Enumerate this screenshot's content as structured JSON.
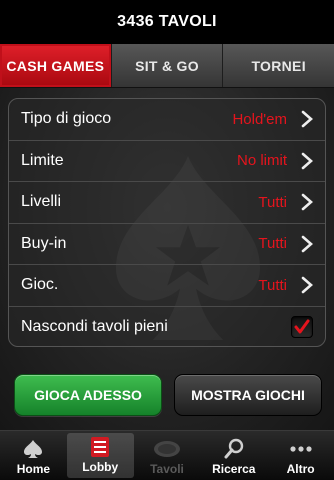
{
  "header": {
    "title": "3436 TAVOLI"
  },
  "segments": [
    {
      "label": "CASH GAMES",
      "active": true
    },
    {
      "label": "SIT & GO",
      "active": false
    },
    {
      "label": "TORNEI",
      "active": false
    }
  ],
  "settings": [
    {
      "label": "Tipo di gioco",
      "value": "Hold'em"
    },
    {
      "label": "Limite",
      "value": "No limit"
    },
    {
      "label": "Livelli",
      "value": "Tutti"
    },
    {
      "label": "Buy-in",
      "value": "Tutti"
    },
    {
      "label": "Gioc.",
      "value": "Tutti"
    }
  ],
  "hide_full": {
    "label": "Nascondi tavoli pieni",
    "checked": true
  },
  "actions": {
    "play_label": "GIOCA ADESSO",
    "show_label": "MOSTRA GIOCHI"
  },
  "tabs": [
    {
      "label": "Home",
      "icon": "spade-icon"
    },
    {
      "label": "Lobby",
      "icon": "lobby-icon",
      "active": true
    },
    {
      "label": "Tavoli",
      "icon": "table-icon",
      "disabled": true
    },
    {
      "label": "Ricerca",
      "icon": "search-icon"
    },
    {
      "label": "Altro",
      "icon": "more-icon"
    }
  ],
  "colors": {
    "accent_red": "#e5141d",
    "play_green": "#2aa53c"
  }
}
